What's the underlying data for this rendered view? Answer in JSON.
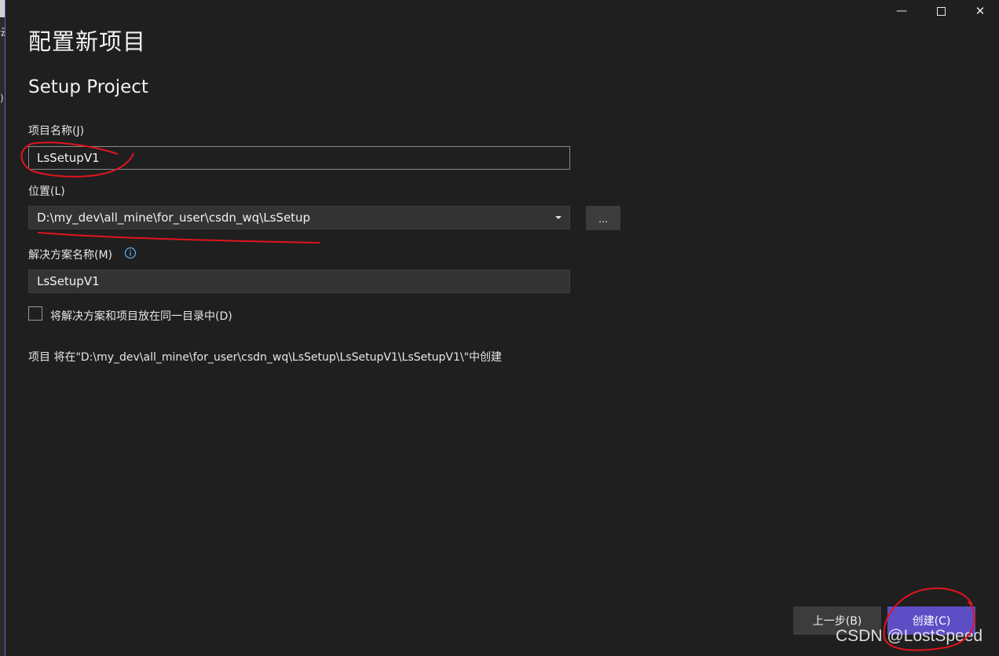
{
  "window": {
    "minimize_symbol": "—",
    "close_symbol": "✕"
  },
  "header": {
    "title": "配置新项目",
    "template_name": "Setup Project"
  },
  "form": {
    "project_name": {
      "label": "项目名称(J)",
      "value": "LsSetupV1"
    },
    "location": {
      "label": "位置(L)",
      "value": "D:\\my_dev\\all_mine\\for_user\\csdn_wq\\LsSetup",
      "browse_label": "..."
    },
    "solution_name": {
      "label": "解决方案名称(M)",
      "value": "LsSetupV1",
      "info_icon": "info-icon"
    },
    "same_directory": {
      "label": "将解决方案和项目放在同一目录中(D)",
      "checked": false
    }
  },
  "summary": "项目 将在\"D:\\my_dev\\all_mine\\for_user\\csdn_wq\\LsSetup\\LsSetupV1\\LsSetupV1\\\"中创建",
  "footer": {
    "back_label": "上一步(B)",
    "create_label": "创建(C)"
  },
  "watermark": "CSDN @LostSpeed",
  "colors": {
    "background": "#1f1f1f",
    "accent": "#5e4ec6",
    "annotation": "#e0141e"
  }
}
